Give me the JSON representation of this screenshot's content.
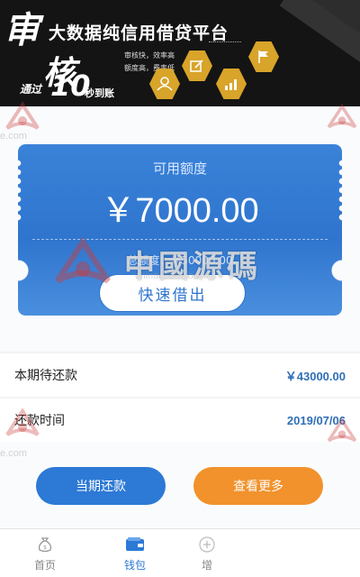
{
  "banner": {
    "calligraphy_1": "审",
    "calligraphy_2": "核",
    "title": "大数据纯信用借贷平台",
    "sub_line_1": "审核快，效率高",
    "sub_line_2": "额度高，费率低",
    "tag_prefix": "通过",
    "tag_number": "10",
    "tag_suffix": "秒到账",
    "icons": [
      "user-icon",
      "edit-icon",
      "chart-icon",
      "flag-icon"
    ]
  },
  "card": {
    "available_label": "可用额度",
    "available_value": "￥7000.00",
    "total_text": "总额度：￥50000.00",
    "borrow_button": "快速借出"
  },
  "rows": [
    {
      "label": "本期待还款",
      "value": "￥43000.00"
    },
    {
      "label": "还款时间",
      "value": "2019/07/06"
    }
  ],
  "actions": {
    "repay_button": "当期还款",
    "more_button": "查看更多"
  },
  "tabbar": {
    "tabs": [
      {
        "label": "首页",
        "icon": "money-bag-icon",
        "active": false
      },
      {
        "label": "钱包",
        "icon": "wallet-icon",
        "active": true
      },
      {
        "label": "增",
        "icon": "plus-icon",
        "active": false
      }
    ]
  },
  "watermark": {
    "site": "chinacode.com",
    "site_short": "e.com",
    "big_text": "中國源碼"
  },
  "colors": {
    "primary": "#2c79d6",
    "accent_orange": "#f1922c",
    "value_blue": "#2f6fb6",
    "banner_gold": "#d8a429"
  }
}
